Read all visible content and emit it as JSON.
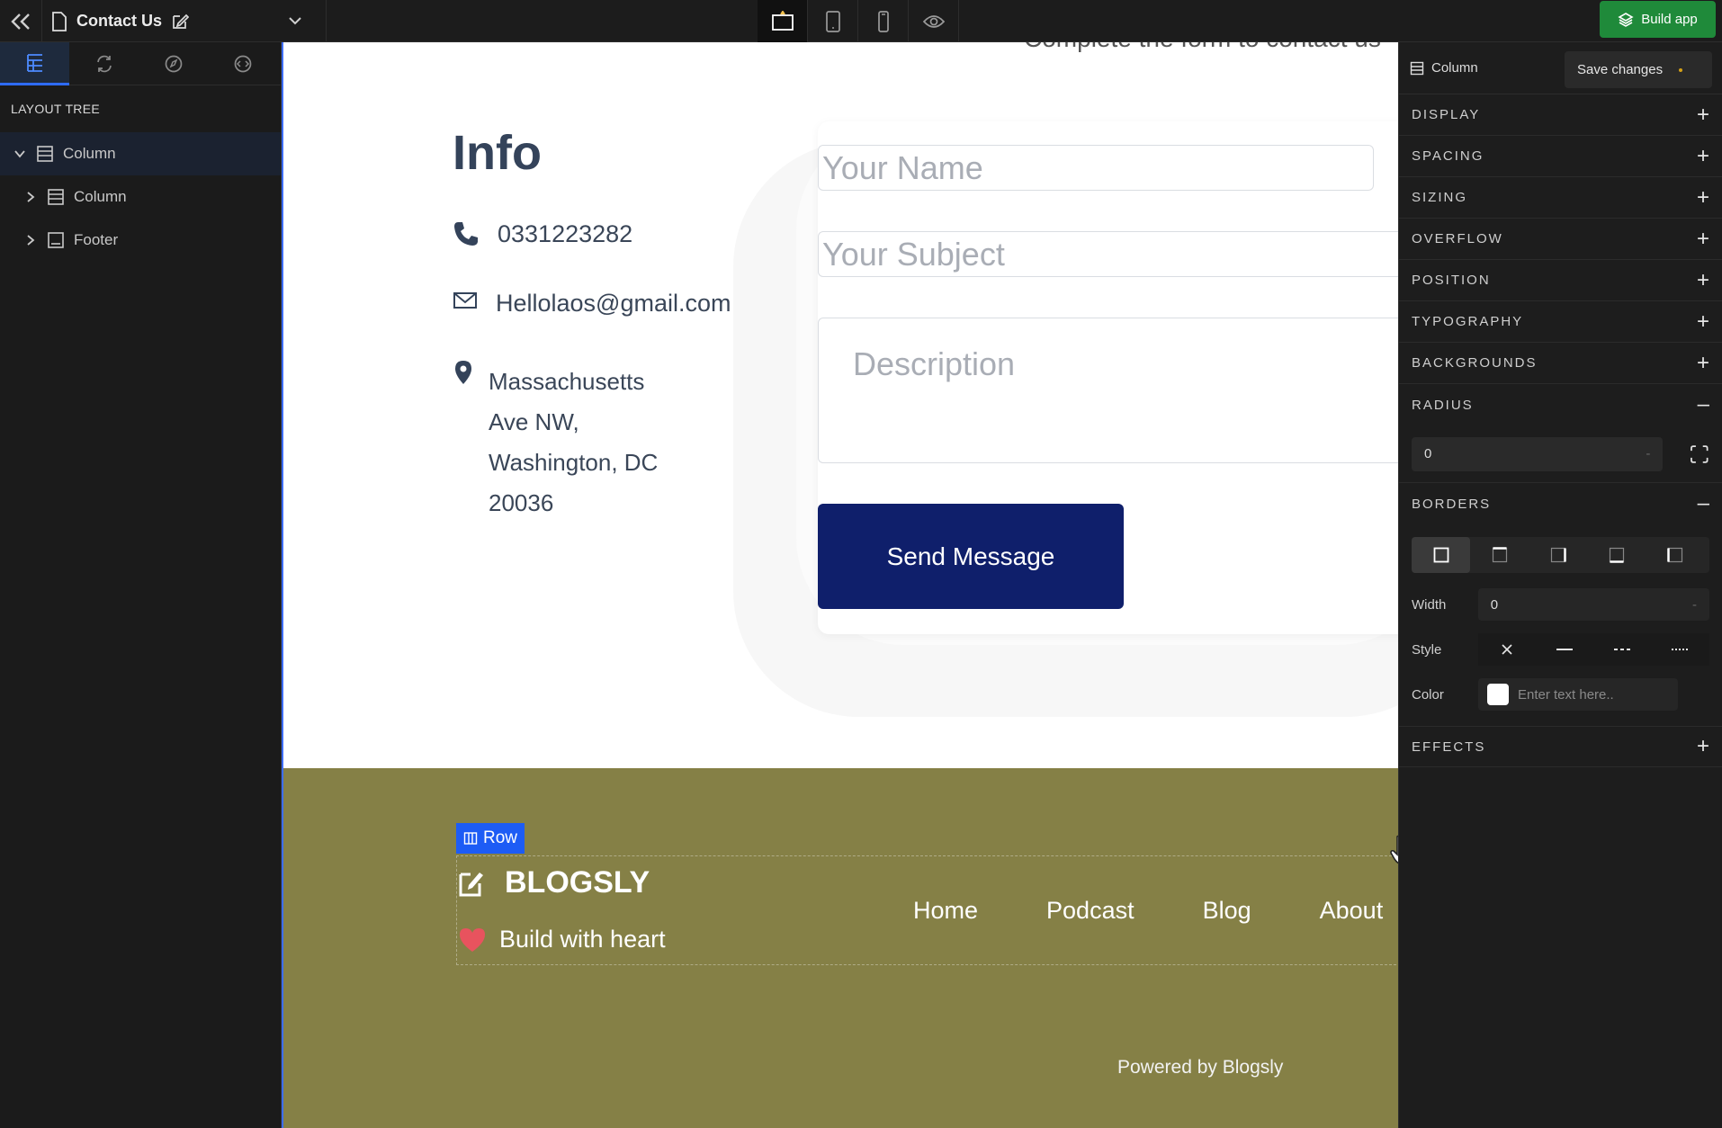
{
  "topbar": {
    "page_title": "Contact Us",
    "build_label": "Build app"
  },
  "left": {
    "heading": "LAYOUT TREE",
    "tree": [
      {
        "label": "Column",
        "expanded": true
      },
      {
        "label": "Column",
        "expanded": false
      },
      {
        "label": "Footer",
        "expanded": false
      }
    ]
  },
  "canvas": {
    "cut_text": "Complete the form to contact us",
    "info_title": "Info",
    "phone": "0331223282",
    "email": "Hellolaos@gmail.com",
    "address_lines": [
      "Massachusetts",
      "Ave NW,",
      "Washington, DC",
      "20036"
    ],
    "form": {
      "name_placeholder": "Your Name",
      "subject_placeholder": "Your Subject",
      "description_placeholder": "Description",
      "send_label": "Send Message"
    },
    "footer": {
      "row_tag": "Row",
      "brand": "BLOGSLY",
      "tagline": "Build with heart",
      "nav": [
        "Home",
        "Podcast",
        "Blog",
        "About"
      ],
      "powered": "Powered by Blogsly",
      "bg_color": "#858046"
    }
  },
  "right": {
    "selected_label": "Column",
    "save_label": "Save changes",
    "sections_top": [
      "DISPLAY",
      "SPACING",
      "SIZING",
      "OVERFLOW",
      "POSITION",
      "TYPOGRAPHY",
      "BACKGROUNDS"
    ],
    "radius_label": "RADIUS",
    "radius_value": "0",
    "borders_label": "BORDERS",
    "width_label": "Width",
    "width_value": "0",
    "style_label": "Style",
    "color_label": "Color",
    "color_placeholder": "Enter text here..",
    "effects_label": "EFFECTS"
  }
}
